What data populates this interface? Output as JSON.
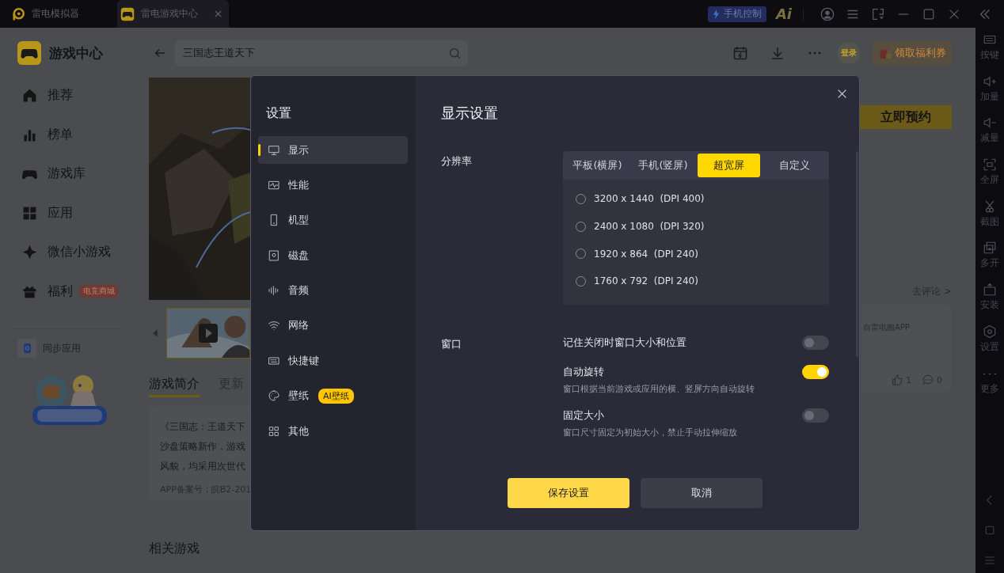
{
  "title_bar": {
    "tabs": [
      {
        "label": "雷电模拟器",
        "selected": false,
        "closable": false
      },
      {
        "label": "雷电游戏中心",
        "selected": true,
        "closable": true
      }
    ],
    "phone_control": "手机控制",
    "ai": "Ai"
  },
  "sidebar": {
    "title": "游戏中心",
    "items": [
      {
        "label": "推荐"
      },
      {
        "label": "榜单"
      },
      {
        "label": "游戏库"
      },
      {
        "label": "应用"
      },
      {
        "label": "微信小游戏"
      },
      {
        "label": "福利",
        "badge": "电竞商城"
      }
    ],
    "sync": "同步应用"
  },
  "header": {
    "search": {
      "value": "三国志王道天下"
    },
    "login": "登录",
    "coupon": "领取福利券"
  },
  "game": {
    "reserve": "立即预约",
    "tabs": [
      {
        "label": "游戏简介",
        "selected": true
      },
      {
        "label": "更新",
        "selected": false
      }
    ],
    "description": [
      "《三国志：王道天下",
      "沙盘策略新作，游戏",
      "风貌，均采用次世代"
    ],
    "license": "APP备案号：皖B2-201",
    "comments_link": "去评论 >",
    "comment": {
      "text": "自雷电圈APP",
      "likes": "1",
      "replies": "0"
    },
    "related_title": "相关游戏"
  },
  "toolbar": {
    "items": [
      {
        "label": "按键"
      },
      {
        "label": "加量"
      },
      {
        "label": "减量"
      },
      {
        "label": "全屏"
      },
      {
        "label": "截图"
      },
      {
        "label": "多开"
      },
      {
        "label": "安装"
      },
      {
        "label": "设置"
      },
      {
        "label": "更多"
      }
    ]
  },
  "settings": {
    "title": "设置",
    "menu": [
      {
        "label": "显示",
        "selected": true
      },
      {
        "label": "性能",
        "selected": false
      },
      {
        "label": "机型",
        "selected": false
      },
      {
        "label": "磁盘",
        "selected": false
      },
      {
        "label": "音频",
        "selected": false
      },
      {
        "label": "网络",
        "selected": false
      },
      {
        "label": "快捷键",
        "selected": false
      },
      {
        "label": "壁纸",
        "selected": false,
        "badge": "AI壁纸"
      },
      {
        "label": "其他",
        "selected": false
      }
    ],
    "panel_title": "显示设置",
    "resolution": {
      "label": "分辨率",
      "modes": [
        {
          "label": "平板(横屏)",
          "selected": false
        },
        {
          "label": "手机(竖屏)",
          "selected": false
        },
        {
          "label": "超宽屏",
          "selected": true
        },
        {
          "label": "自定义",
          "selected": false
        }
      ],
      "options": [
        {
          "label": "3200 x 1440  (DPI 400)",
          "selected": false
        },
        {
          "label": "2400 x 1080  (DPI 320)",
          "selected": false
        },
        {
          "label": "1920 x 864  (DPI 240)",
          "selected": false
        },
        {
          "label": "1760 x 792  (DPI 240)",
          "selected": false
        }
      ]
    },
    "window": {
      "label": "窗口",
      "settings": [
        {
          "label": "记住关闭时窗口大小和位置",
          "on": false
        },
        {
          "label": "自动旋转",
          "on": true,
          "description": "窗口根据当前游戏或应用的横、竖屏方向自动旋转"
        },
        {
          "label": "固定大小",
          "on": false,
          "description": "窗口尺寸固定为初始大小，禁止手动拉伸缩放"
        }
      ]
    },
    "buttons": [
      {
        "label": "保存设置",
        "kind": "primary"
      },
      {
        "label": "取消",
        "kind": "secondary"
      }
    ]
  }
}
